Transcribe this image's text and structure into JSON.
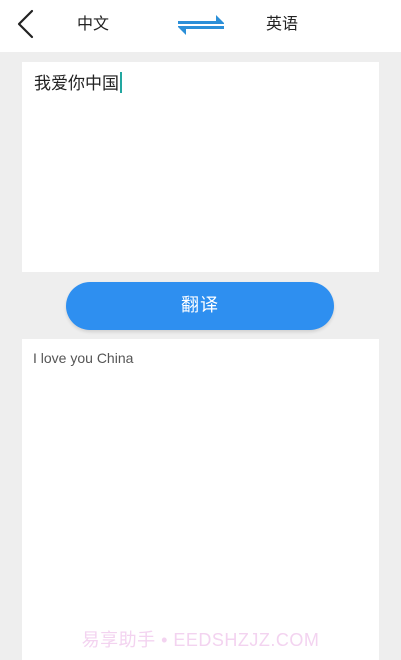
{
  "header": {
    "source_language": "中文",
    "target_language": "英语",
    "back_icon": "chevron-left-icon",
    "swap_icon": "swap-arrows-icon",
    "accent_color": "#2e8ff0"
  },
  "input": {
    "text": "我爱你中国"
  },
  "translate_button": {
    "label": "翻译",
    "color": "#2e8ff0"
  },
  "output": {
    "text": "I love you China"
  },
  "watermark": {
    "text": "易享助手 • EEDSHZJZ.COM"
  }
}
